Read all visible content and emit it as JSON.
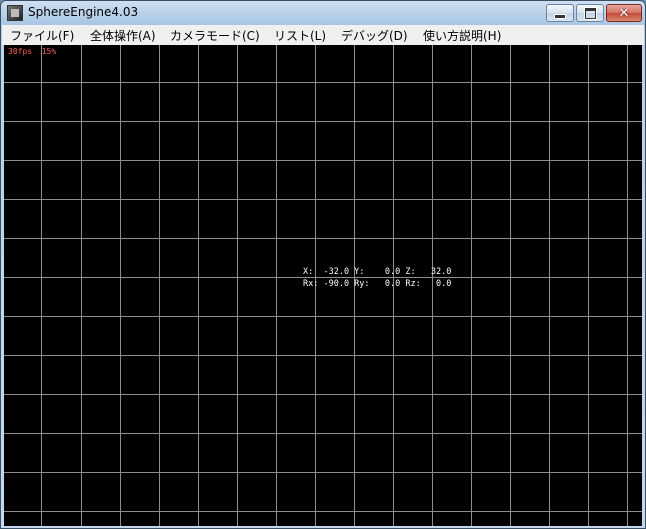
{
  "window": {
    "title": "SphereEngine4.03"
  },
  "menu": [
    "ファイル(F)",
    "全体操作(A)",
    "カメラモード(C)",
    "リスト(L)",
    "デバッグ(D)",
    "使い方説明(H)"
  ],
  "hud": {
    "fps": "30fps",
    "load": "15%"
  },
  "coords": {
    "line1": "X:  -32.0 Y:    0.0 Z:   32.0",
    "line2": "Rx: -90.0 Ry:   0.0 Rz:   0.0"
  },
  "colors": {
    "grid": "#8d8d8d",
    "viewport_bg": "#000000",
    "hud_text": "#ff5a5a"
  }
}
